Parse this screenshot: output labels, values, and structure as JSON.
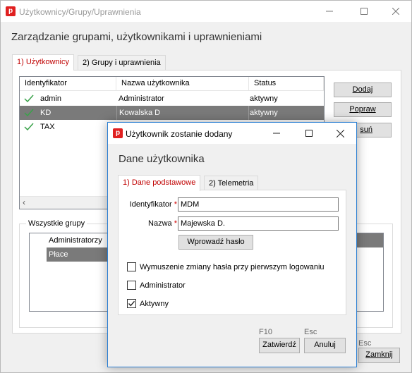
{
  "outer": {
    "title": "Użytkownicy/Grupy/Uprawnienia",
    "heading": "Zarządzanie grupami, użytkownikami i uprawnieniami",
    "tabs": [
      "1) Użytkownicy",
      "2) Grupy i uprawnienia"
    ],
    "table": {
      "columns": [
        "Identyfikator",
        "Nazwa użytkownika",
        "Status"
      ],
      "rows": [
        {
          "id": "admin",
          "name": "Administrator",
          "status": "aktywny"
        },
        {
          "id": "KD",
          "name": "Kowalska D",
          "status": "aktywny"
        },
        {
          "id": "TAX",
          "name": "",
          "status": ""
        }
      ]
    },
    "buttons": {
      "add": "Dodaj",
      "edit": "Popraw",
      "remove_partial": "suń"
    },
    "groups": {
      "legend": "Wszystkie grupy",
      "items": [
        "Administratorzy",
        "Płace"
      ]
    },
    "close_shortcut": "Esc",
    "close_button": "Zamknij"
  },
  "dialog": {
    "title": "Użytkownik zostanie dodany",
    "heading": "Dane użytkownika",
    "tabs": [
      "1) Dane podstawowe",
      "2) Telemetria"
    ],
    "identifier_label": "Identyfikator",
    "identifier_value": "MDM",
    "name_label": "Nazwa",
    "name_value": "Majewska D.",
    "required_mark": "*",
    "password_button": "Wprowadź hasło",
    "checkboxes": [
      {
        "label": "Wymuszenie zmiany hasła przy pierwszym logowaniu",
        "checked": false
      },
      {
        "label": "Administrator",
        "checked": false
      },
      {
        "label": "Aktywny",
        "checked": true
      }
    ],
    "confirm_shortcut": "F10",
    "confirm_button": "Zatwierdź",
    "cancel_shortcut": "Esc",
    "cancel_button": "Anuluj"
  },
  "colors": {
    "accent": "#c00000",
    "selection": "#7a7a7a",
    "check": "#3aa24a",
    "logo": "#e02020"
  }
}
